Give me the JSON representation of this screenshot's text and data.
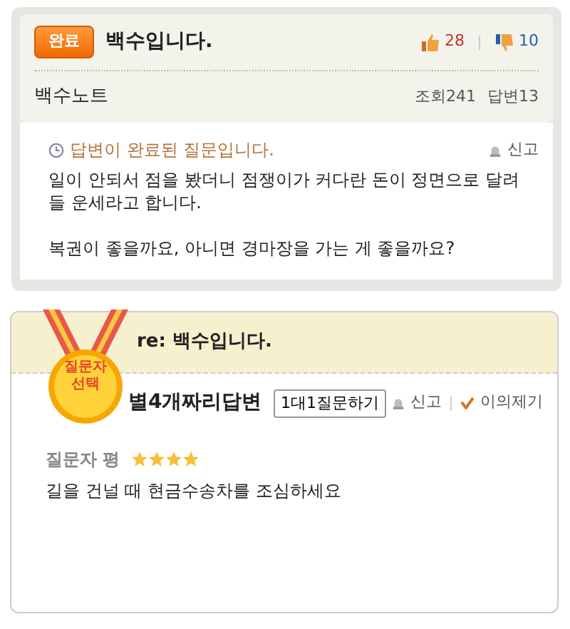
{
  "question": {
    "status_badge": "완료",
    "title": "백수입니다.",
    "likes": "28",
    "dislikes": "10",
    "author": "백수노트",
    "views": "조회241",
    "answers": "답변13",
    "notice": "답변이 완료된 질문입니다.",
    "report": "신고",
    "body": [
      "일이 안되서 점을 봤더니 점쟁이가 커다란 돈이 정면으로 달려들 운세라고 합니다.",
      "복권이 좋을까요, 아니면 경마장을 가는 게 좋을까요?"
    ]
  },
  "answer": {
    "medal": [
      "질문자",
      "선택"
    ],
    "title": "re: 백수입니다.",
    "author": "별4개짜리답변",
    "ask_button": "1대1질문하기",
    "report": "신고",
    "objection": "이의제기",
    "rating_label": "질문자 평",
    "stars": 4,
    "body": "길을 건널 때 현금수송차를 조심하세요"
  }
}
